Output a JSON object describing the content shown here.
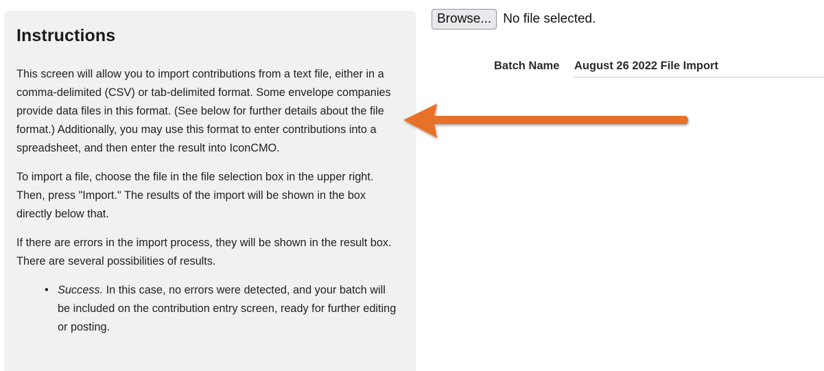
{
  "instructions": {
    "title": "Instructions",
    "paragraphs": [
      "This screen will allow you to import contributions from a text file, either in a comma-delimited (CSV) or tab-delimited format. Some envelope companies provide data files in this format. (See below for further details about the file format.) Additionally, you may use this format to enter contributions into a spreadsheet, and then enter the result into IconCMO.",
      "To import a file, choose the file in the file selection box in the upper right. Then, press \"Import.\" The results of the import will be shown in the box directly below that.",
      "If there are errors in the import process, they will be shown in the result box. There are several possibilities of results."
    ],
    "bullets": [
      {
        "bullet": "•",
        "term": "Success.",
        "text": " In this case, no errors were detected, and your batch will be included on the contribution entry screen, ready for further editing or posting."
      }
    ]
  },
  "file_picker": {
    "browse_label": "Browse...",
    "status": "No file selected."
  },
  "batch": {
    "label": "Batch Name",
    "value": "August 26 2022 File Import"
  },
  "annotation": {
    "arrow_color": "#e8712a",
    "arrow_direction": "left"
  }
}
